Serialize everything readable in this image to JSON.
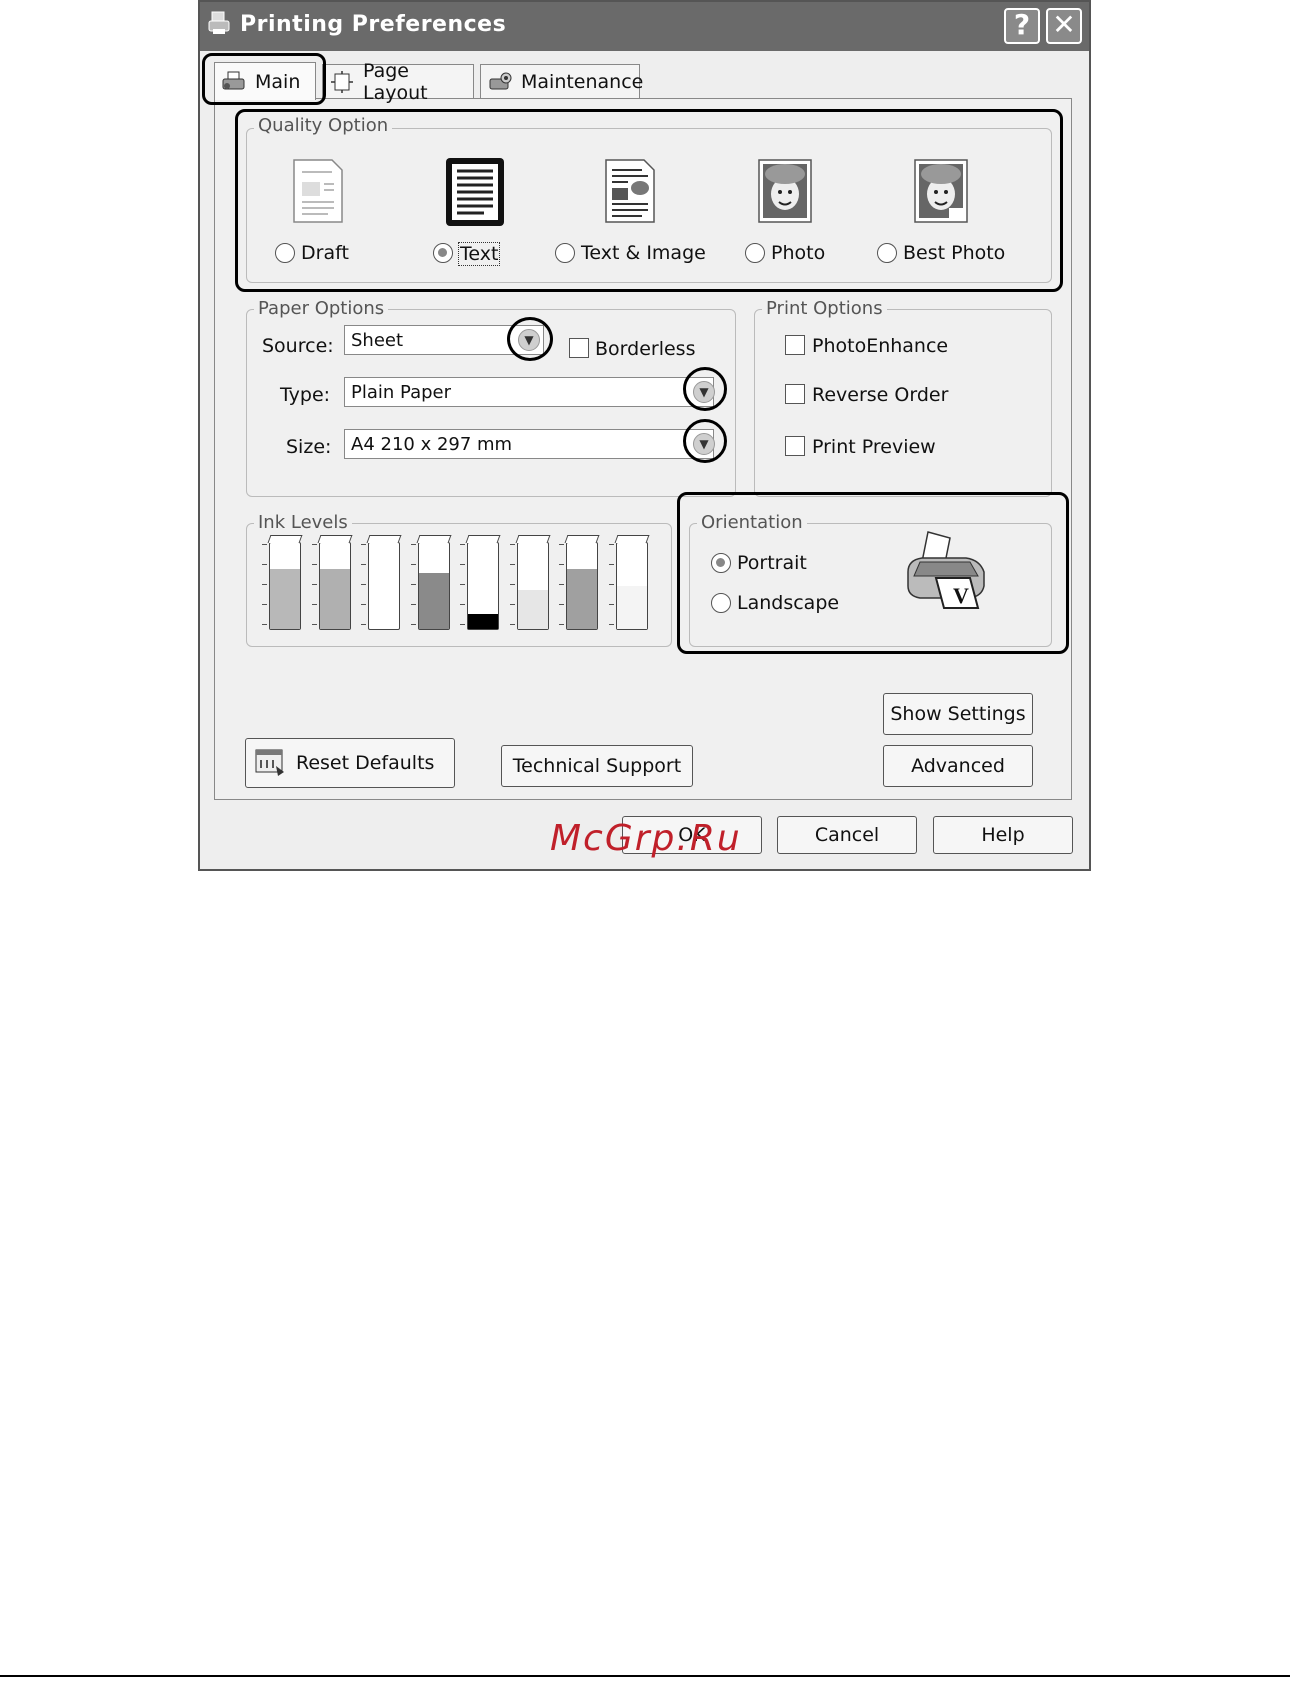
{
  "window": {
    "title": "Printing Preferences",
    "help_glyph": "?",
    "close_glyph": "✕"
  },
  "tabs": [
    {
      "label": "Main",
      "icon": "printer-icon",
      "active": true
    },
    {
      "label": "Page Layout",
      "icon": "page-layout-icon",
      "active": false
    },
    {
      "label": "Maintenance",
      "icon": "maintenance-icon",
      "active": false
    }
  ],
  "quality": {
    "group_label": "Quality Option",
    "options": [
      {
        "label": "Draft",
        "selected": false
      },
      {
        "label": "Text",
        "selected": true
      },
      {
        "label": "Text & Image",
        "selected": false
      },
      {
        "label": "Photo",
        "selected": false
      },
      {
        "label": "Best Photo",
        "selected": false
      }
    ]
  },
  "paper": {
    "group_label": "Paper Options",
    "source_label": "Source:",
    "source_value": "Sheet",
    "borderless_label": "Borderless",
    "type_label": "Type:",
    "type_value": "Plain Paper",
    "size_label": "Size:",
    "size_value": "A4 210 x 297 mm"
  },
  "print_options": {
    "group_label": "Print Options",
    "items": [
      {
        "label": "PhotoEnhance",
        "checked": false
      },
      {
        "label": "Reverse Order",
        "checked": false
      },
      {
        "label": "Print Preview",
        "checked": false
      }
    ]
  },
  "ink": {
    "group_label": "Ink Levels",
    "levels": [
      0.7,
      0.7,
      0.0,
      0.65,
      0.18,
      0.45,
      0.7,
      0.5
    ],
    "colors": [
      "#b8b8b8",
      "#b0b0b0",
      "#ffffff",
      "#8a8a8a",
      "#000000",
      "#e6e6e6",
      "#a0a0a0",
      "#f4f4f4"
    ]
  },
  "orientation": {
    "group_label": "Orientation",
    "portrait_label": "Portrait",
    "portrait_selected": true,
    "landscape_label": "Landscape",
    "landscape_selected": false
  },
  "buttons": {
    "show_settings": "Show Settings",
    "advanced": "Advanced",
    "reset_defaults": "Reset Defaults",
    "technical_support": "Technical Support",
    "ok": "OK",
    "cancel": "Cancel",
    "help": "Help"
  },
  "watermark": "McGrp.Ru"
}
